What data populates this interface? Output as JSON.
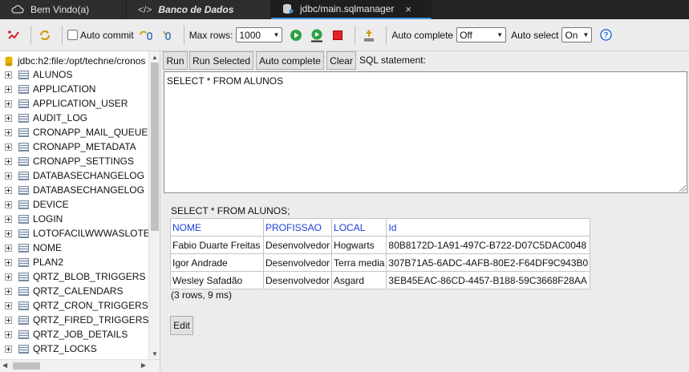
{
  "tabs": [
    {
      "label": "Bem Vindo(a)",
      "icon": "cloud-icon"
    },
    {
      "label": "Banco de Dados",
      "icon": "code-icon"
    },
    {
      "label": "jdbc/main.sqlmanager",
      "icon": "database-icon",
      "close": "×"
    }
  ],
  "toolbar": {
    "auto_commit": "Auto commit",
    "max_rows_label": "Max rows:",
    "max_rows_value": "1000",
    "auto_complete_label": "Auto complete",
    "auto_complete_value": "Off",
    "auto_select_label": "Auto select",
    "auto_select_value": "On"
  },
  "tree": {
    "root": "jdbc:h2:file:/opt/techne/cronos",
    "items": [
      "ALUNOS",
      "APPLICATION",
      "APPLICATION_USER",
      "AUDIT_LOG",
      "CRONAPP_MAIL_QUEUE",
      "CRONAPP_METADATA",
      "CRONAPP_SETTINGS",
      "DATABASECHANGELOG",
      "DATABASECHANGELOG",
      "DEVICE",
      "LOGIN",
      "LOTOFACILWWWASLOTE",
      "NOME",
      "PLAN2",
      "QRTZ_BLOB_TRIGGERS",
      "QRTZ_CALENDARS",
      "QRTZ_CRON_TRIGGERS",
      "QRTZ_FIRED_TRIGGERS",
      "QRTZ_JOB_DETAILS",
      "QRTZ_LOCKS"
    ]
  },
  "sql": {
    "run": "Run",
    "run_selected": "Run Selected",
    "auto_complete": "Auto complete",
    "clear": "Clear",
    "statement_label": "SQL statement:",
    "query": "SELECT * FROM ALUNOS"
  },
  "results": {
    "query_echo": "SELECT * FROM ALUNOS;",
    "columns": [
      "NOME",
      "PROFISSAO",
      "LOCAL",
      "Id"
    ],
    "rows": [
      [
        "Fabio Duarte Freitas",
        "Desenvolvedor",
        "Hogwarts",
        "80B8172D-1A91-497C-B722-D07C5DAC0048"
      ],
      [
        "Igor Andrade",
        "Desenvolvedor",
        "Terra media",
        "307B71A5-6ADC-4AFB-80E2-F64DF9C943B0"
      ],
      [
        "Wesley Safadão",
        "Desenvolvedor",
        "Asgard",
        "3EB45EAC-86CD-4457-B188-59C3668F28AA"
      ]
    ],
    "row_count": "(3 rows, 9 ms)",
    "edit": "Edit"
  },
  "colors": {
    "header_link": "#1a3fd6",
    "tab_bg": "#252526",
    "accent": "#3c8fe0"
  }
}
